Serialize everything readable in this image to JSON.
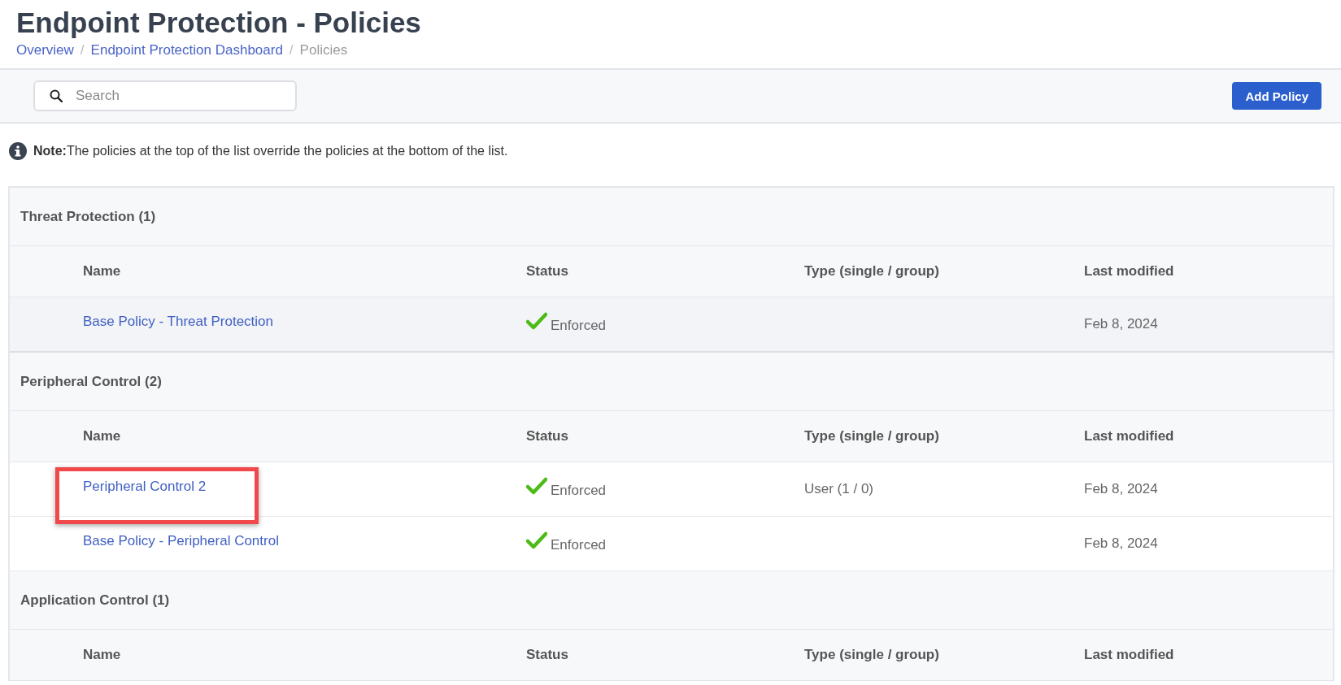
{
  "page": {
    "title": "Endpoint Protection - Policies"
  },
  "breadcrumbs": [
    {
      "label": "Overview",
      "current": false,
      "separator": "/"
    },
    {
      "label": "Endpoint Protection Dashboard",
      "current": false,
      "separator": "/"
    },
    {
      "label": "Policies",
      "current": true
    }
  ],
  "toolbar": {
    "search": {
      "placeholder": "Search"
    },
    "add_button": "Add Policy"
  },
  "note": {
    "text": "**Note:**The policies at the top of the list override the policies at the bottom of the list."
  },
  "groups": [
    {
      "title": "Threat Protection (1)",
      "columns": [
        "Name",
        "Status",
        "Type (single / group)",
        "Last modified"
      ],
      "rows": [
        {
          "name": "Base Policy - Threat Protection",
          "status": "Enforced",
          "enforced": true,
          "type": "",
          "modified": "Feb 8, 2024",
          "highlighted": true,
          "annotated": false
        }
      ]
    },
    {
      "title": "Peripheral Control (2)",
      "columns": [
        "Name",
        "Status",
        "Type (single / group)",
        "Last modified"
      ],
      "rows": [
        {
          "name": "Peripheral Control 2",
          "status": "Enforced",
          "enforced": true,
          "type": "User (1 / 0)",
          "modified": "Feb 8, 2024",
          "highlighted": false,
          "annotated": true
        },
        {
          "name": "Base Policy - Peripheral Control",
          "status": "Enforced",
          "enforced": true,
          "type": "",
          "modified": "Feb 8, 2024",
          "highlighted": false,
          "annotated": false
        }
      ]
    },
    {
      "title": "Application Control (1)",
      "columns": [
        "Name",
        "Status",
        "Type (single / group)",
        "Last modified"
      ]
    }
  ]
}
